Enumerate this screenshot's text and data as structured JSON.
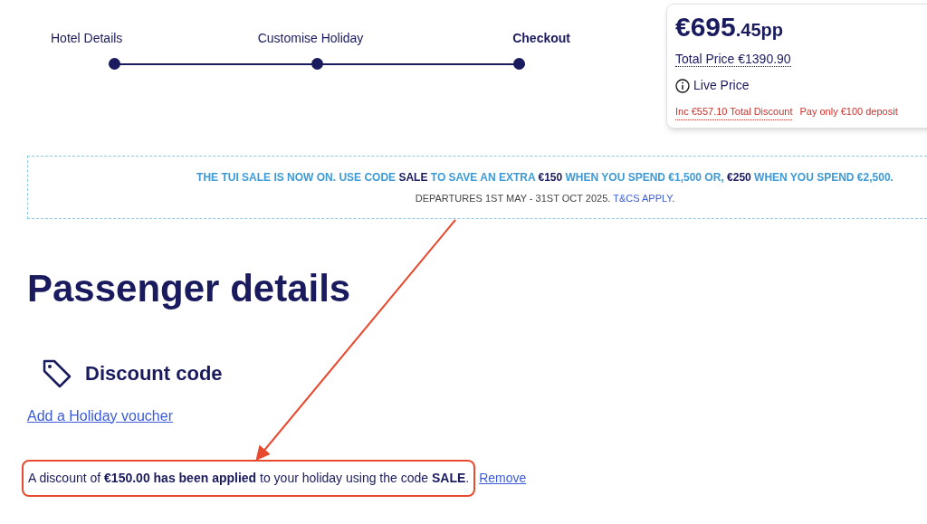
{
  "progress_steps": [
    {
      "label": "Hotel Details",
      "selected": false
    },
    {
      "label": "Customise Holiday",
      "selected": false
    },
    {
      "label": "Checkout",
      "selected": true
    }
  ],
  "price_card": {
    "price_main": "€695",
    "price_decimals": ".45",
    "price_unit": "pp",
    "total_price": "Total Price €1390.90",
    "live_price": "Live Price",
    "discount_total": "Inc €557.10 Total Discount",
    "deposit": "Pay only €100 deposit"
  },
  "sale_banner": {
    "headline": "THE TUI SALE IS NOW ON. USE CODE **SALE** TO SAVE AN EXTRA **€150** WHEN YOU SPEND €1,500 OR, **€250** WHEN YOU SPEND €2,500.",
    "subline": "DEPARTURES 1ST MAY - 31ST OCT 2025. ",
    "terms_link": "T&CS APPLY",
    "subline_end": "."
  },
  "page_title": "Passenger details",
  "discount_section": {
    "title": "Discount code",
    "voucher_link": "Add a Holiday voucher",
    "applied_message": "A discount of **€150.00 has been applied** to your holiday using the code **SALE**.",
    "remove_link": "Remove"
  }
}
